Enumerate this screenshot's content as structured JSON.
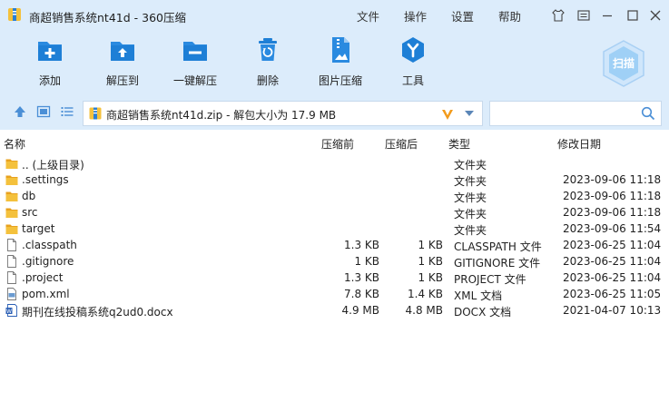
{
  "app": {
    "title": "商超销售系统nt41d - 360压缩",
    "menus": [
      "文件",
      "操作",
      "设置",
      "帮助"
    ]
  },
  "toolbar": {
    "items": [
      {
        "label": "添加",
        "icon": "add-icon"
      },
      {
        "label": "解压到",
        "icon": "extract-to-icon"
      },
      {
        "label": "一键解压",
        "icon": "one-click-extract-icon"
      },
      {
        "label": "删除",
        "icon": "delete-icon"
      },
      {
        "label": "图片压缩",
        "icon": "image-compress-icon"
      },
      {
        "label": "工具",
        "icon": "tools-icon"
      }
    ],
    "scan_label": "扫描"
  },
  "address": {
    "path": "商超销售系统nt41d.zip - 解包大小为 17.9 MB",
    "search_value": ""
  },
  "table": {
    "headers": [
      "名称",
      "压缩前",
      "压缩后",
      "类型",
      "修改日期"
    ],
    "rows": [
      {
        "name": ".. (上级目录)",
        "kind": "folder",
        "before": "",
        "after": "",
        "type": "文件夹",
        "date": ""
      },
      {
        "name": ".settings",
        "kind": "folder",
        "before": "",
        "after": "",
        "type": "文件夹",
        "date": "2023-09-06 11:18"
      },
      {
        "name": "db",
        "kind": "folder",
        "before": "",
        "after": "",
        "type": "文件夹",
        "date": "2023-09-06 11:18"
      },
      {
        "name": "src",
        "kind": "folder",
        "before": "",
        "after": "",
        "type": "文件夹",
        "date": "2023-09-06 11:18"
      },
      {
        "name": "target",
        "kind": "folder",
        "before": "",
        "after": "",
        "type": "文件夹",
        "date": "2023-09-06 11:54"
      },
      {
        "name": ".classpath",
        "kind": "file",
        "before": "1.3 KB",
        "after": "1 KB",
        "type": "CLASSPATH 文件",
        "date": "2023-06-25 11:04"
      },
      {
        "name": ".gitignore",
        "kind": "file",
        "before": "1 KB",
        "after": "1 KB",
        "type": "GITIGNORE 文件",
        "date": "2023-06-25 11:04"
      },
      {
        "name": ".project",
        "kind": "file",
        "before": "1.3 KB",
        "after": "1 KB",
        "type": "PROJECT 文件",
        "date": "2023-06-25 11:04"
      },
      {
        "name": "pom.xml",
        "kind": "xml",
        "before": "7.8 KB",
        "after": "1.4 KB",
        "type": "XML 文档",
        "date": "2023-06-25 11:05"
      },
      {
        "name": "期刊在线投稿系统q2ud0.docx",
        "kind": "docx",
        "before": "4.9 MB",
        "after": "4.8 MB",
        "type": "DOCX 文档",
        "date": "2021-04-07 10:13"
      }
    ]
  },
  "colors": {
    "chrome": "#dcecfb",
    "accent": "#1e88d8",
    "folder": "#f4c13c"
  }
}
